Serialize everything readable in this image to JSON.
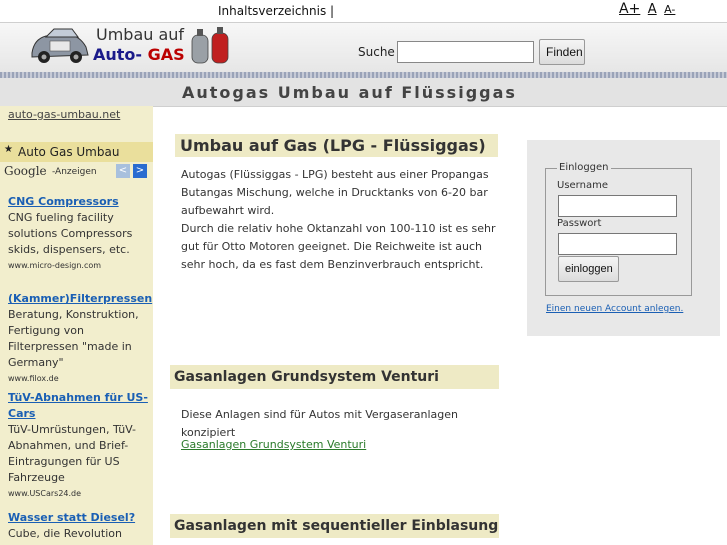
{
  "topbar": {
    "toc": "Inhaltsverzeichnis |",
    "font_large": "A+",
    "font_medium": "A",
    "font_small": "A-"
  },
  "header": {
    "logo_line1": "Umbau auf",
    "logo_line2_a": "Auto-",
    "logo_line2_b": "GAS",
    "search_label": "Suche",
    "search_value": "",
    "search_button": "Finden"
  },
  "page_title": "Autogas Umbau auf Flüssiggas",
  "sidebar": {
    "site_link": "auto-gas-umbau.net",
    "nav_item": "Auto Gas Umbau",
    "google_logo": "Google",
    "google_ads": "-Anzeigen",
    "arrow_left": "<",
    "arrow_right": ">",
    "ads": [
      {
        "title": "CNG Compressors",
        "text": "CNG fueling facility solutions Compressors skids, dispensers, etc.",
        "url": "www.micro-design.com"
      },
      {
        "title": "(Kammer)Filterpressen",
        "text": "Beratung, Konstruktion, Fertigung von Filterpressen \"made in Germany\"",
        "url": "www.filox.de"
      },
      {
        "title": "TüV-Abnahmen für US-Cars",
        "text": "TüV-Umrüstungen, TüV-Abnahmen, und Brief-Eintragungen für US Fahrzeuge",
        "url": "www.USCars24.de"
      },
      {
        "title": "Wasser statt Diesel?",
        "text": "Cube, die Revolution",
        "url": ""
      }
    ]
  },
  "main": {
    "section1": {
      "heading": "Umbau auf Gas (LPG - Flüssiggas)",
      "para1": "Autogas (Flüssiggas - LPG) besteht aus einer Propangas Butangas Mischung, welche in Drucktanks von 6-20 bar aufbewahrt wird.",
      "para2": "Durch die relativ hohe Oktanzahl von 100-110 ist es sehr gut für Otto Motoren geeignet. Die Reichweite ist auch sehr hoch, da es fast dem Benzinverbrauch entspricht."
    },
    "section2": {
      "heading": "Gasanlagen Grundsystem Venturi",
      "text": "Diese Anlagen sind für Autos mit Vergaseranlagen konzipiert",
      "link": "Gasanlagen Grundsystem Venturi"
    },
    "section3": {
      "heading": "Gasanlagen mit sequentieller Einblasung"
    }
  },
  "login": {
    "legend": "Einloggen",
    "username_label": "Username",
    "username_value": "",
    "password_label": "Passwort",
    "password_value": "",
    "button": "einloggen",
    "new_account": "Einen neuen Account anlegen."
  }
}
